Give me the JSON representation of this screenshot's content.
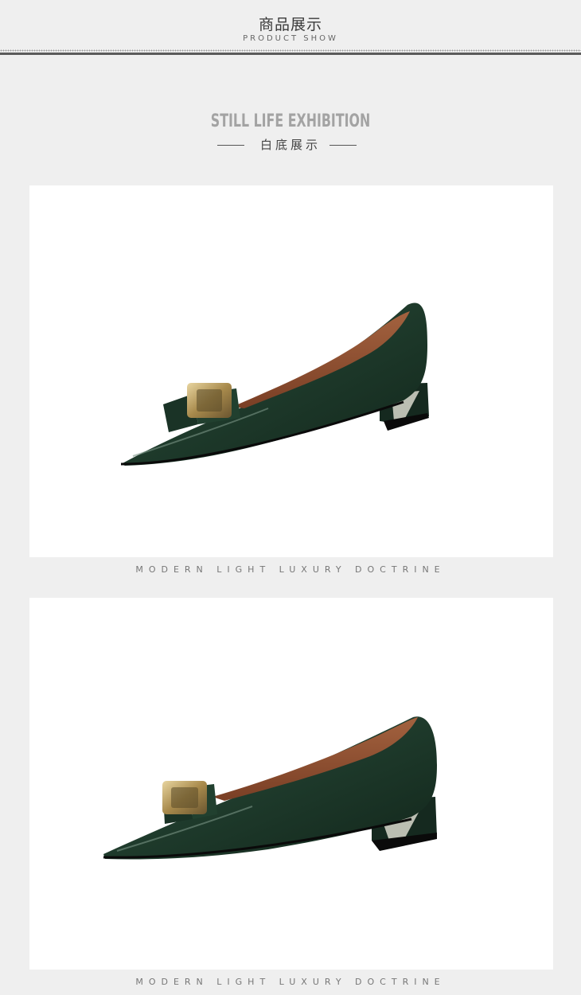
{
  "header": {
    "title_cn": "商品展示",
    "title_en": "PRODUCT SHOW"
  },
  "section": {
    "title_en": "STILL LIFE EXHIBITION",
    "title_cn": "白底展示"
  },
  "panels": [
    {
      "caption": "MODERN   LIGHT   LUXURY DOCTRINE",
      "image": "green-patent-pointed-pump-side-view"
    },
    {
      "caption": "MODERN   LIGHT   LUXURY DOCTRINE",
      "image": "green-patent-pointed-pump-three-quarter-view"
    }
  ],
  "colors": {
    "background": "#efefef",
    "panel": "#ffffff",
    "shoe_green": "#1f3a2c",
    "lining_brown": "#8b4a2e",
    "buckle_gold": "#b89a5a"
  }
}
